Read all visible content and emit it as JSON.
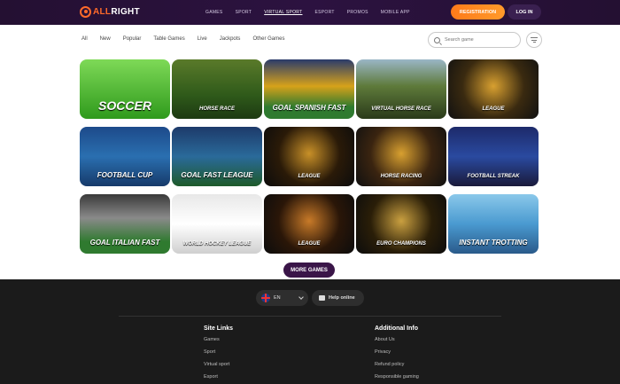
{
  "header": {
    "logo_text_accent": "ALL",
    "logo_text_main": "RIGHT",
    "nav": [
      "GAMES",
      "SPORT",
      "VIRTUAL SPORT",
      "ESPORT",
      "PROMOS",
      "MOBILE APP"
    ],
    "active_nav": "VIRTUAL SPORT",
    "register_label": "REGISTRATION",
    "login_label": "LOG IN"
  },
  "filters": [
    "All",
    "New",
    "Popular",
    "Table Games",
    "Live",
    "Jackpots",
    "Other Games"
  ],
  "search": {
    "placeholder": "Search game"
  },
  "games": [
    {
      "label": "SOCCER",
      "size": "big",
      "bg": "linear-gradient(180deg,#7ed957,#2f9a1c)"
    },
    {
      "label": "HORSE RACE",
      "size": "small",
      "bg": "linear-gradient(180deg,#5a7a2a,#2f5a1a 60%,#1d3a12)"
    },
    {
      "label": "GOAL SPANISH FAST",
      "size": "med",
      "bg": "linear-gradient(180deg,#2a3b6b,#d6a21a 45%,#2f7a2f 80%)"
    },
    {
      "label": "VIRTUAL HORSE RACE",
      "size": "small",
      "bg": "linear-gradient(180deg,#9ab6c6,#5e7a3a 45%,#2a3a1a)"
    },
    {
      "label": "LEAGUE",
      "size": "small",
      "bg": "radial-gradient(circle at 50% 45%,#d8a030,#3a2a10 55%,#111)"
    },
    {
      "label": "FOOTBALL CUP",
      "size": "med",
      "bg": "linear-gradient(180deg,#1d4a8a,#2a6fb0 50%,#163a6a)"
    },
    {
      "label": "GOAL FAST LEAGUE",
      "size": "med",
      "bg": "linear-gradient(180deg,#1d3a6a,#2a6a9a 50%,#1e5a2a)"
    },
    {
      "label": "LEAGUE",
      "size": "small",
      "bg": "radial-gradient(circle at 50% 45%,#c89028,#2a1a08 55%,#0c0c0c)"
    },
    {
      "label": "HORSE RACING",
      "size": "small",
      "bg": "radial-gradient(circle at 50% 45%,#d8a030,#3a2410 55%,#101010)"
    },
    {
      "label": "FOOTBALL STREAK",
      "size": "small",
      "bg": "linear-gradient(180deg,#1d2a6a,#2a4aa0 50%,#1a1a3a)"
    },
    {
      "label": "GOAL ITALIAN FAST",
      "size": "med",
      "bg": "linear-gradient(180deg,#3a3a3a,#8a8a8a 40%,#2f7a2f 80%)"
    },
    {
      "label": "WORLD HOCKEY LEAGUE",
      "size": "small",
      "bg": "linear-gradient(180deg,#e8e8e8,#ffffff 50%,#cfcfcf)"
    },
    {
      "label": "LEAGUE",
      "size": "small",
      "bg": "radial-gradient(circle at 50% 45%,#c87a28,#2a1608 55%,#0c0c0c)"
    },
    {
      "label": "EURO CHAMPIONS",
      "size": "small",
      "bg": "radial-gradient(circle at 50% 45%,#caa040,#2a1e08 55%,#0c0c0c)"
    },
    {
      "label": "INSTANT TROTTING",
      "size": "med",
      "bg": "linear-gradient(180deg,#8ac8ea,#4a9ad0 50%,#2a5a8a)"
    }
  ],
  "more_games_label": "MORE GAMES",
  "footer": {
    "language": "EN",
    "help_label": "Help online",
    "site_links_title": "Site Links",
    "site_links": [
      "Games",
      "Sport",
      "Virtual sport",
      "Esport"
    ],
    "additional_title": "Additional Info",
    "additional_links": [
      "About Us",
      "Privacy",
      "Refund policy",
      "Responsible gaming"
    ]
  }
}
